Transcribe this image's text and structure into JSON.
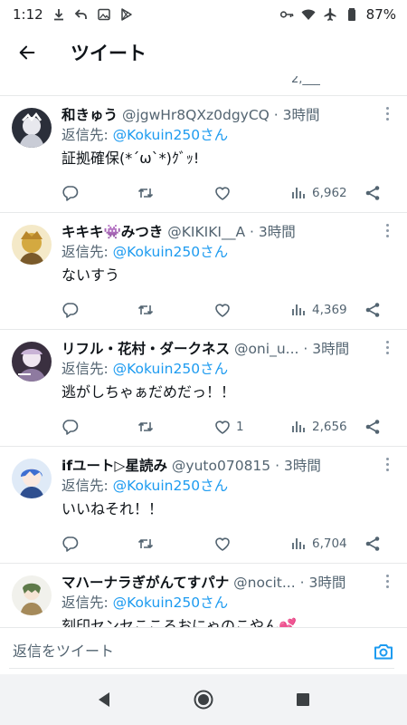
{
  "status_bar": {
    "time": "1:12",
    "battery": "87%",
    "left_icons": [
      "download-icon",
      "reply-arrow-icon",
      "image-icon",
      "play-store-icon"
    ],
    "right_icons": [
      "key-icon",
      "wifi-icon",
      "airplane-icon",
      "battery-icon"
    ]
  },
  "app_bar": {
    "title": "ツイート",
    "back_icon": "back-arrow-icon"
  },
  "feed": {
    "partial_stat": "2,___",
    "tweets": [
      {
        "display_name": "和きゅう",
        "handle": "@jgwHr8QXz0dgyCQ",
        "dot": "·",
        "time": "3時間",
        "reply_prefix": "返信先: ",
        "reply_to": "@Kokuin250さん",
        "text": "証拠確保(*´ω`*)ｸﾞｯ!",
        "replies": "",
        "retweets": "",
        "likes": "",
        "views": "6,962"
      },
      {
        "display_name": "キキキ👾みつき",
        "handle": "@KIKIKI__A",
        "dot": "·",
        "time": "3時間",
        "reply_prefix": "返信先: ",
        "reply_to": "@Kokuin250さん",
        "text": "ないすう",
        "replies": "",
        "retweets": "",
        "likes": "",
        "views": "4,369"
      },
      {
        "display_name": "リフル・花村・ダークネス",
        "handle": "@oni_u...",
        "dot": "·",
        "time": "3時間",
        "reply_prefix": "返信先: ",
        "reply_to": "@Kokuin250さん",
        "text": "逃がしちゃぁだめだっ！！",
        "replies": "",
        "retweets": "",
        "likes": "1",
        "views": "2,656"
      },
      {
        "display_name": "ifユート▷星読み",
        "handle": "@yuto070815",
        "dot": "·",
        "time": "3時間",
        "reply_prefix": "返信先: ",
        "reply_to": "@Kokuin250さん",
        "text": "いいねそれ！！",
        "replies": "",
        "retweets": "",
        "likes": "",
        "views": "6,704"
      },
      {
        "display_name": "マハーナラぎがんてすパナ",
        "handle": "@nocit...",
        "dot": "·",
        "time": "3時間",
        "reply_prefix": "返信先: ",
        "reply_to": "@Kokuin250さん",
        "text": "刻印センセこころおにゃのこやん💕",
        "replies": "",
        "retweets": "",
        "likes": "",
        "views": ""
      }
    ]
  },
  "reply_bar": {
    "placeholder": "返信をツイート",
    "camera_icon": "camera-icon"
  },
  "nav_bar": {
    "icons": [
      "back-triangle-icon",
      "home-circle-icon",
      "recents-square-icon"
    ]
  },
  "colors": {
    "accent": "#1d9bf0",
    "secondary_text": "#536471",
    "primary_text": "#0f1419",
    "divider": "#e7e9ea"
  }
}
